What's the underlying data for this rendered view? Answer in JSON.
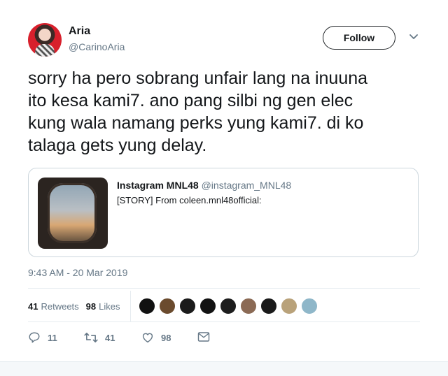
{
  "author": {
    "name": "Aria",
    "handle": "@CarinoAria"
  },
  "follow_label": "Follow",
  "tweet_text": "sorry ha pero sobrang unfair lang na inuuna\nito kesa kami7. ano pang silbi ng gen elec\nkung wala namang perks yung kami7. di ko\ntalaga gets yung delay.",
  "quote": {
    "name": "Instagram MNL48",
    "handle": "@instagram_MNL48",
    "text": "[STORY] From coleen.mnl48official:"
  },
  "timestamp": "9:43 AM - 20 Mar 2019",
  "stats": {
    "retweets_count": "41",
    "retweets_label": "Retweets",
    "likes_count": "98",
    "likes_label": "Likes"
  },
  "likers_colors": [
    "#111111",
    "#6b4b2e",
    "#1b1b1b",
    "#121212",
    "#1d1d1d",
    "#8b6a55",
    "#1a1a1a",
    "#b9a27a",
    "#8fb7c9"
  ],
  "actions": {
    "replies": "11",
    "retweets": "41",
    "likes": "98"
  },
  "colors": {
    "text": "#14171a",
    "secondary": "#657786",
    "border": "#e6ecf0"
  },
  "icons": [
    "chevron-down-icon",
    "reply-icon",
    "retweet-icon",
    "heart-icon",
    "message-icon"
  ]
}
